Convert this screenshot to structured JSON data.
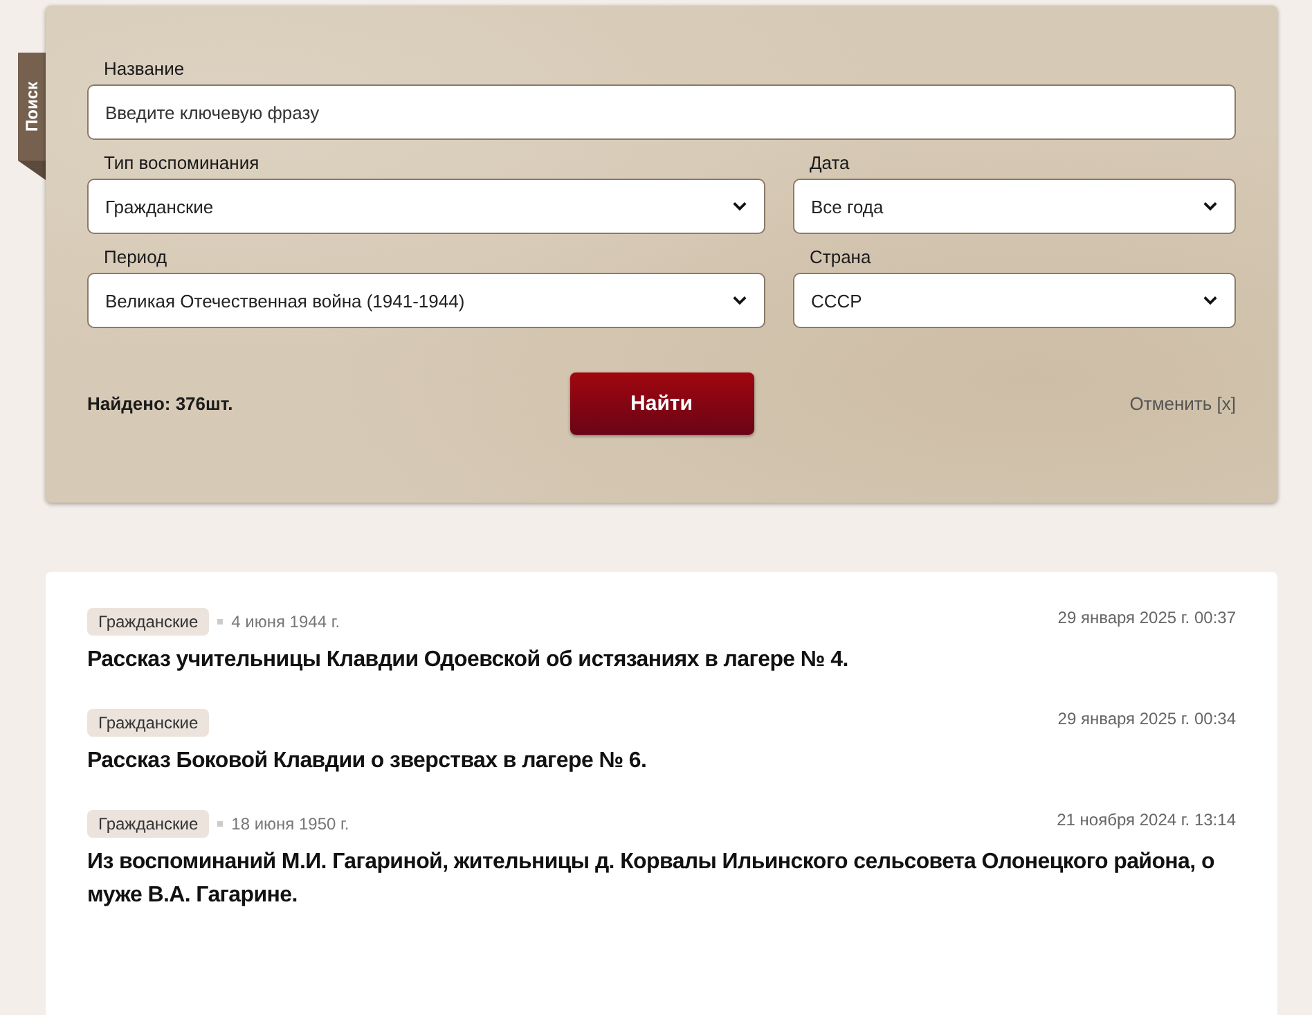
{
  "search_tab": {
    "label": "Поиск"
  },
  "search": {
    "fields": [
      {
        "kind": "text",
        "label": "Название",
        "placeholder": "Введите ключевую фразу"
      },
      {
        "kind": "select",
        "label": "Тип воспоминания",
        "value": "Гражданские"
      },
      {
        "kind": "select",
        "label": "Дата",
        "value": "Все года"
      },
      {
        "kind": "select",
        "label": "Период",
        "value": "Великая Отечественная война (1941-1944)"
      },
      {
        "kind": "select",
        "label": "Страна",
        "value": "СССР"
      }
    ],
    "found": "Найдено: 376шт.",
    "submit": "Найти",
    "reset": "Отменить [x]"
  },
  "results": [
    {
      "tag": "Гражданские",
      "event_date": "4 июня 1944 г.",
      "posted": "29 января 2025 г. 00:37",
      "title": "Рассказ учительницы Клавдии Одоевской об истязаниях в лагере № 4."
    },
    {
      "tag": "Гражданские",
      "posted": "29 января 2025 г. 00:34",
      "title": "Рассказ Боковой Клавдии о зверствах в лагере № 6."
    },
    {
      "tag": "Гражданские",
      "event_date": "18 июня 1950 г.",
      "posted": "21 ноября 2024 г. 13:14",
      "title": "Из воспоминаний М.И. Гагариной, жительницы д. Корвалы Ильинского сельсовета Олонецкого района, о муже В.А. Гагарине."
    }
  ]
}
